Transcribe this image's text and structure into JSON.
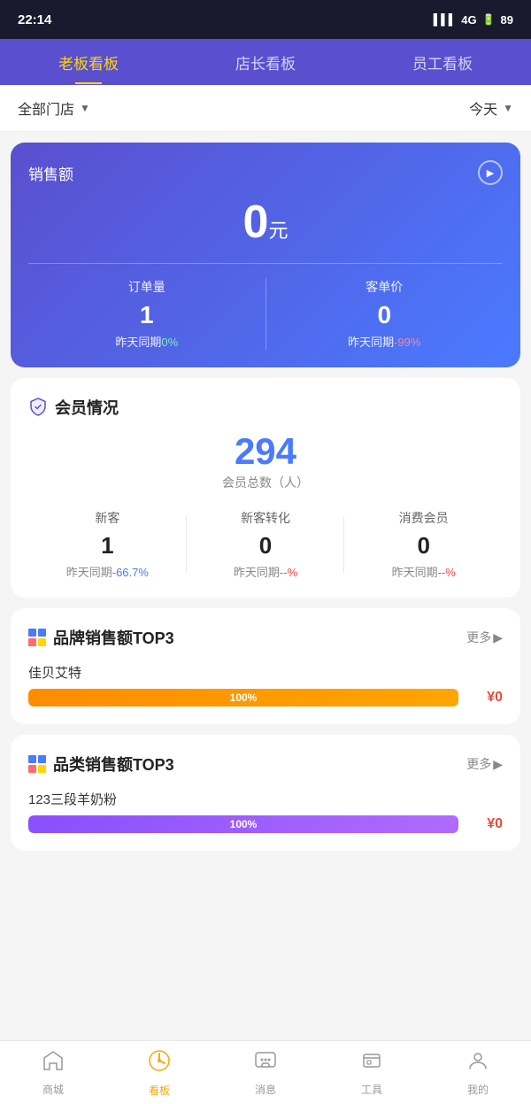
{
  "statusBar": {
    "time": "22:14",
    "signal": "4G",
    "battery": "89"
  },
  "navTabs": {
    "tabs": [
      {
        "id": "boss",
        "label": "老板看板",
        "active": true
      },
      {
        "id": "manager",
        "label": "店长看板",
        "active": false
      },
      {
        "id": "staff",
        "label": "员工看板",
        "active": false
      }
    ]
  },
  "filterBar": {
    "storeLabel": "全部门店",
    "dateLabel": "今天"
  },
  "salesCard": {
    "title": "销售额",
    "amount": "0",
    "unit": "元",
    "ordersLabel": "订单量",
    "ordersValue": "1",
    "ordersCompareLabel": "昨天同期",
    "ordersPct": "0%",
    "avgPriceLabel": "客单价",
    "avgPriceValue": "0",
    "avgPriceCompareLabel": "昨天同期",
    "avgPricePct": "-99%"
  },
  "memberSection": {
    "title": "会员情况",
    "totalNumber": "294",
    "totalLabel": "会员总数（人）",
    "stats": [
      {
        "label": "新客",
        "value": "1",
        "compareLabel": "昨天同期",
        "pct": "-66.7%",
        "pctColor": "blue"
      },
      {
        "label": "新客转化",
        "value": "0",
        "compareLabel": "昨天同期",
        "pct": "--%",
        "pctColor": "red"
      },
      {
        "label": "消费会员",
        "value": "0",
        "compareLabel": "昨天同期",
        "pct": "--%",
        "pctColor": "red"
      }
    ]
  },
  "brandTop3": {
    "title": "品牌销售额TOP3",
    "moreLabel": "更多",
    "items": [
      {
        "name": "佳贝艾特",
        "pct": 100,
        "pctLabel": "100%",
        "amount": "¥0",
        "barColor": "orange"
      }
    ]
  },
  "categoryTop3": {
    "title": "品类销售额TOP3",
    "moreLabel": "更多",
    "items": [
      {
        "name": "123三段羊奶粉",
        "pct": 100,
        "pctLabel": "100%",
        "amount": "¥0",
        "barColor": "purple"
      }
    ]
  },
  "bottomNav": {
    "items": [
      {
        "id": "shop",
        "label": "商城",
        "active": false,
        "icon": "🏠"
      },
      {
        "id": "dashboard",
        "label": "看板",
        "active": true,
        "icon": "📊"
      },
      {
        "id": "message",
        "label": "消息",
        "active": false,
        "icon": "💬"
      },
      {
        "id": "tools",
        "label": "工具",
        "active": false,
        "icon": "🧰"
      },
      {
        "id": "mine",
        "label": "我的",
        "active": false,
        "icon": "👤"
      }
    ]
  }
}
